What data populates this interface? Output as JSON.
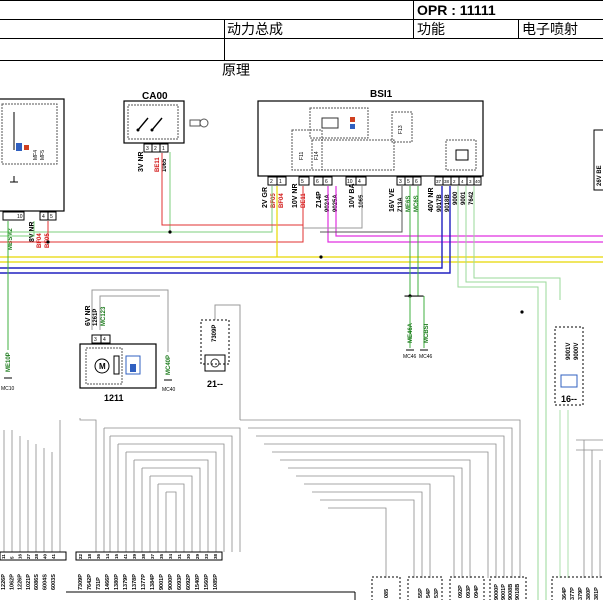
{
  "header": {
    "opr": "OPR : 11111",
    "group": "动力总成",
    "function_label": "功能",
    "function_value": "电子喷射",
    "section": "原理"
  },
  "components": {
    "ca00": {
      "label": "CA00",
      "connector": "3V NR",
      "pins": [
        "3",
        "2",
        "1"
      ],
      "wires": [
        "BE11",
        "1065"
      ]
    },
    "bsi1": {
      "label": "BSI1",
      "connectors": [
        "2V GR",
        "10V NR",
        "Z14P",
        "10V BA",
        "16V VE",
        "40V NR"
      ],
      "pins_a": [
        "2",
        "1"
      ],
      "pins_b": [
        "5"
      ],
      "pins_c": [
        "6",
        "6"
      ],
      "pins_d": [
        "10",
        "4"
      ],
      "pins_e": [
        "3",
        "5",
        "6"
      ],
      "pins_f": [
        "37",
        "38",
        "2",
        "4",
        "3",
        "40"
      ],
      "wires": [
        "BF05",
        "BF04",
        "BE11",
        "9024A",
        "9025A",
        "1065",
        "Z13A",
        "ME6S",
        "MC6S",
        "9017B",
        "9018B",
        "9000",
        "9001",
        "7642"
      ],
      "fuses": [
        "F11",
        "F14",
        "F13"
      ]
    },
    "left_ecu": {
      "connector": "8V NR",
      "pins": [
        "10",
        "4",
        "5"
      ],
      "wires": [
        "MBSM2",
        "BF04",
        "BF05"
      ],
      "side": [
        "MF4",
        "MF5"
      ]
    },
    "c1211": {
      "label": "1211",
      "connector": "6V NR",
      "pins": [
        "3",
        "4"
      ],
      "wires": [
        "1261P",
        "MC123"
      ],
      "right_wire": "MC40P",
      "ground": "MC40"
    },
    "c7309": {
      "pin": "7309P",
      "num": "21--"
    },
    "right_conn": {
      "wires": [
        "9001V",
        "9000V"
      ],
      "num": "16--"
    },
    "right_edge": "26V BE",
    "grounds_mid": {
      "wires": [
        "ME46A",
        "MCBSI"
      ],
      "labels": [
        "MC46",
        "MC46"
      ]
    },
    "left_ground": {
      "wire": "ME10P",
      "label": "MC10"
    }
  },
  "bottom_labels": {
    "group1": [
      "1226P",
      "1062P",
      "1226P",
      "1021P",
      "6086S",
      "6004S",
      "6003S"
    ],
    "group1_pins": [
      "11",
      "5",
      "16",
      "27",
      "28",
      "40",
      "41"
    ],
    "group2": [
      "7309P",
      "7642P",
      "731P",
      "1466P",
      "1380P",
      "1379P",
      "1378P",
      "1377P",
      "1384P",
      "9001P",
      "9000P",
      "6093P",
      "6092P",
      "1540P",
      "1560P",
      "1085P"
    ],
    "group2_pins": [
      "22",
      "18",
      "36",
      "14",
      "15",
      "41",
      "39",
      "38",
      "37",
      "35",
      "34",
      "31",
      "30",
      "29",
      "33",
      "38"
    ],
    "group3": [
      "085"
    ],
    "group4": [
      "55P",
      "54P",
      "53P"
    ],
    "group5": [
      "092P",
      "093P",
      "094P"
    ],
    "group6": [
      "9000P",
      "9001P",
      "9008B",
      "9018B"
    ],
    "group7": [
      "364P",
      "377P",
      "379P",
      "380P",
      "381P"
    ]
  }
}
